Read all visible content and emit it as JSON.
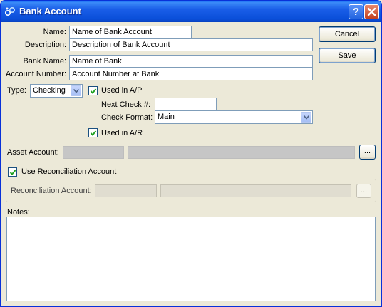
{
  "window": {
    "title": "Bank Account",
    "help_label": "?",
    "icon": "app-link-icon"
  },
  "form": {
    "name_label": "Name:",
    "name_value": "Name of Bank Account",
    "description_label": "Description:",
    "description_value": "Description of Bank Account",
    "bank_name_label": "Bank Name:",
    "bank_name_value": "Name of Bank",
    "account_number_label": "Account Number:",
    "account_number_value": "Account Number at Bank",
    "type_label": "Type:",
    "type_value": "Checking",
    "used_in_ap_label": "Used in A/P",
    "used_in_ap_checked": true,
    "next_check_label": "Next Check #:",
    "next_check_value": "",
    "check_format_label": "Check Format:",
    "check_format_value": "Main",
    "used_in_ar_label": "Used in A/R",
    "used_in_ar_checked": true,
    "asset_account_label": "Asset Account:",
    "asset_account_number": "",
    "asset_account_desc": "",
    "browse_label": "...",
    "use_recon_label": "Use Reconciliation Account",
    "use_recon_checked": true,
    "recon_account_label": "Reconciliation Account:",
    "recon_account_number": "",
    "recon_account_desc": "",
    "notes_label": "Notes:",
    "notes_value": ""
  },
  "buttons": {
    "cancel_label": "Cancel",
    "save_label": "Save"
  },
  "colors": {
    "titlebar": "#0a4fd9",
    "window_bg": "#ece9d8",
    "input_border": "#7f9db9"
  }
}
